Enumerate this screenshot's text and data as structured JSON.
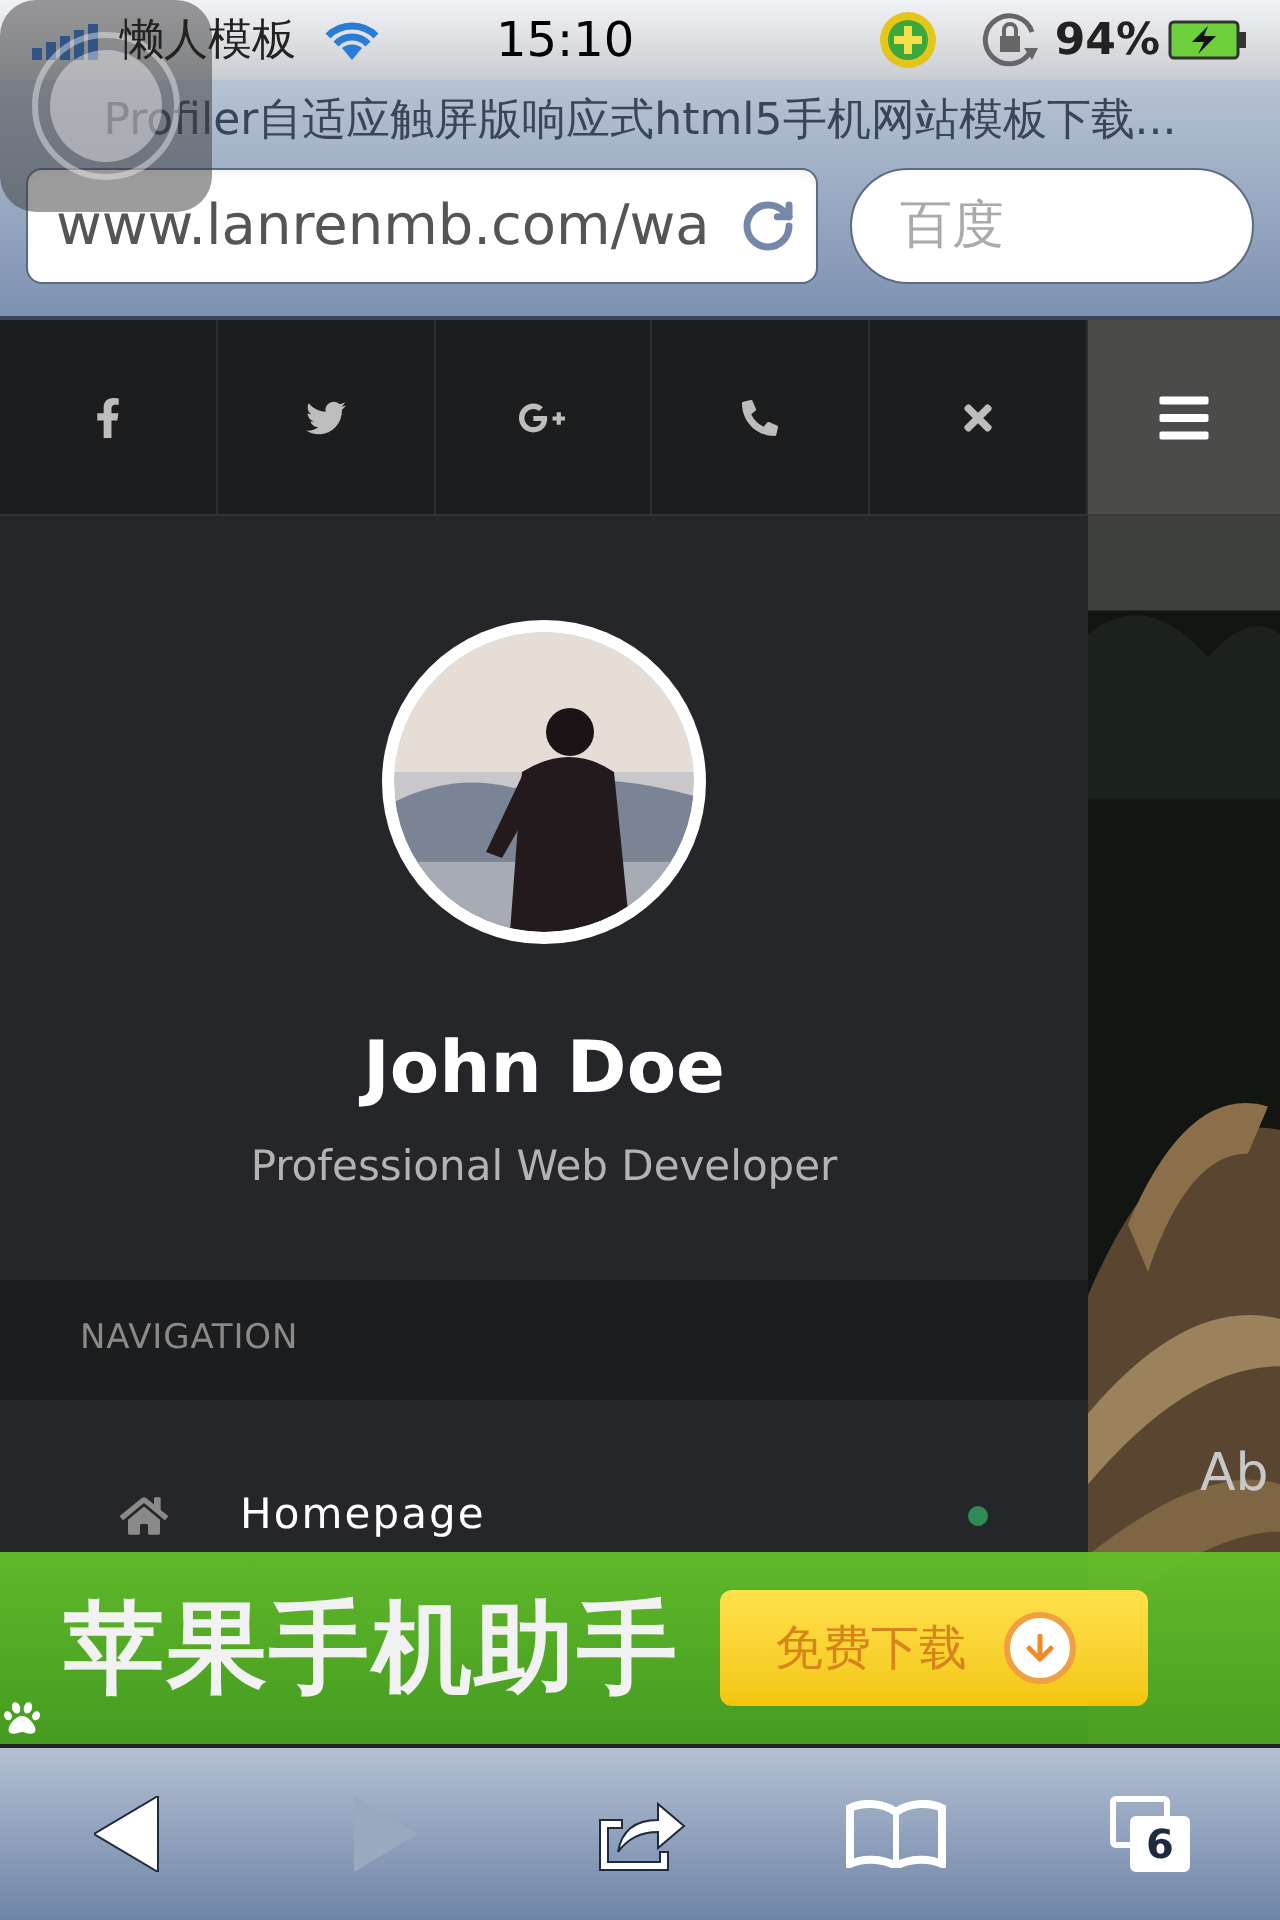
{
  "status_bar": {
    "carrier": "懒人模板",
    "time": "15:10",
    "battery": "94%"
  },
  "browser": {
    "page_title": "Profiler自适应触屏版响应式html5手机网站模板下载...",
    "url": "www.lanrenmb.com/wa",
    "search": {
      "placeholder": "百度"
    }
  },
  "social_buttons": [
    {
      "kind": "facebook"
    },
    {
      "kind": "twitter"
    },
    {
      "kind": "googleplus"
    },
    {
      "kind": "phone"
    },
    {
      "kind": "close"
    }
  ],
  "profile": {
    "name": "John Doe",
    "role": "Professional Web Developer"
  },
  "navigation": {
    "heading": "NAVIGATION",
    "items": [
      {
        "label": "Homepage",
        "kind": "home",
        "selected": true
      }
    ]
  },
  "side_text": "Ab",
  "ad": {
    "title": "苹果手机助手",
    "button": "免费下载"
  },
  "toolbar": [
    {
      "kind": "back",
      "disabled": false
    },
    {
      "kind": "forward",
      "disabled": true
    },
    {
      "kind": "share",
      "disabled": false
    },
    {
      "kind": "bookmarks",
      "disabled": false
    },
    {
      "kind": "tabs",
      "disabled": false,
      "count": "6"
    }
  ]
}
